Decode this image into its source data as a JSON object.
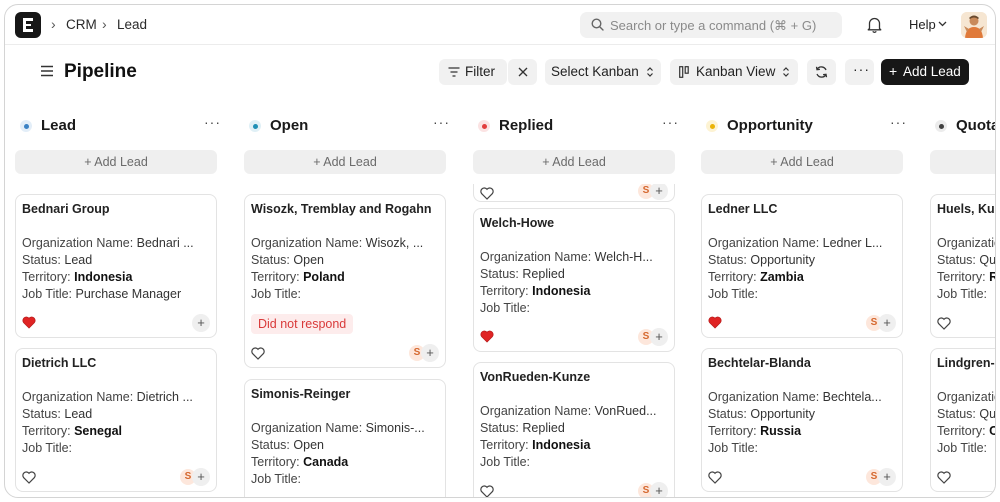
{
  "breadcrumb": {
    "items": [
      "CRM",
      "Lead"
    ]
  },
  "search": {
    "placeholder": "Search or type a command (⌘ + G)"
  },
  "topbar": {
    "help_label": "Help"
  },
  "header": {
    "title": "Pipeline",
    "filter_label": "Filter",
    "kanban_select_label": "Select Kanban",
    "view_label": "Kanban View",
    "add_lead_label": "Add Lead"
  },
  "labels": {
    "add_lead_column": "+ Add Lead",
    "org_prefix": "Organization Name: ",
    "status_prefix": "Status: ",
    "territory_prefix": "Territory: ",
    "job_prefix": "Job Title: "
  },
  "columns": [
    {
      "title": "Lead",
      "color": "#3b82c4",
      "cards": [
        {
          "name": "Bednari Group",
          "org": "Bednari ...",
          "status": "Lead",
          "territory": "Indonesia",
          "job": "Purchase Manager",
          "liked": true,
          "assignee": ""
        },
        {
          "name": "Dietrich LLC",
          "org": "Dietrich ...",
          "status": "Lead",
          "territory": "Senegal",
          "job": "",
          "liked": false,
          "assignee": "S"
        }
      ]
    },
    {
      "title": "Open",
      "color": "#1f8fb5",
      "cards": [
        {
          "name": "Wisozk, Tremblay and Rogahn",
          "org": "Wisozk, ...",
          "status": "Open",
          "territory": "Poland",
          "job": "",
          "tag": "Did not respond",
          "liked": false,
          "assignee": "S"
        },
        {
          "name": "Simonis-Reinger",
          "org": "Simonis-...",
          "status": "Open",
          "territory": "Canada",
          "job": ""
        }
      ]
    },
    {
      "title": "Replied",
      "color": "#e23d3d",
      "cards": [
        {
          "name": "Welch-Howe",
          "org": "Welch-H...",
          "status": "Replied",
          "territory": "Indonesia",
          "job": "",
          "liked": true,
          "assignee": "S"
        },
        {
          "name": "VonRueden-Kunze",
          "org": "VonRued...",
          "status": "Replied",
          "territory": "Indonesia",
          "job": "",
          "liked": false,
          "assignee": "S"
        }
      ]
    },
    {
      "title": "Opportunity",
      "color": "#eab308",
      "cards": [
        {
          "name": "Ledner LLC",
          "org": "Ledner L...",
          "status": "Opportunity",
          "territory": "Zambia",
          "job": "",
          "liked": true,
          "assignee": "S"
        },
        {
          "name": "Bechtelar-Blanda",
          "org": "Bechtela...",
          "status": "Opportunity",
          "territory": "Russia",
          "job": "",
          "liked": false,
          "assignee": "S"
        }
      ]
    },
    {
      "title": "Quota",
      "color": "#404040",
      "cards": [
        {
          "name": "Huels, Kunc",
          "org": "Organizatio",
          "status": "Quo",
          "territory": "R",
          "job": "",
          "liked": false
        },
        {
          "name": "Lindgren-B",
          "org": "Organizatio",
          "status": "Quo",
          "territory": "C",
          "job": "",
          "liked": false
        }
      ]
    }
  ]
}
